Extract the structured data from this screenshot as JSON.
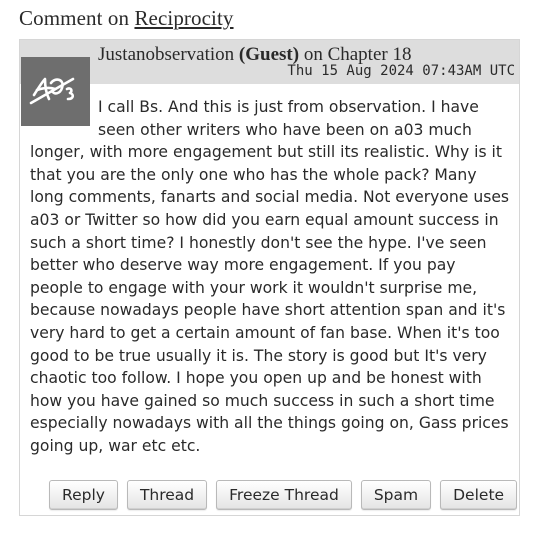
{
  "heading": {
    "prefix": "Comment on",
    "work_title": "Reciprocity"
  },
  "comment": {
    "author": "Justanobservation",
    "guest_tag": "(Guest)",
    "on_text": "on",
    "chapter": "Chapter 18",
    "datetime": "Thu 15 Aug 2024 07:43AM UTC",
    "avatar_icon": "ao3-guest-avatar-icon",
    "body": "I call Bs. And this is just from observation. I have seen other writers who have been on a03 much longer, with more engagement but still its realistic. Why is it that you are the only one who has the whole pack? Many long comments, fanarts and social media. Not everyone uses a03 or Twitter so how did you earn equal amount success in such a short time? I honestly don't see the hype. I've seen better who deserve way more engagement. If you pay people to engage with your work it wouldn't surprise me, because nowadays people have short attention span and it's very hard to get a certain amount of fan base. When it's too good to be true usually it is. The story is good but It's very chaotic too follow. I hope you open up and be honest with how you have gained so much success in such a short time especially nowadays with all the things going on, Gass prices going up, war etc etc."
  },
  "actions": {
    "reply": "Reply",
    "thread": "Thread",
    "freeze_thread": "Freeze Thread",
    "spam": "Spam",
    "delete": "Delete"
  },
  "colors": {
    "header_bg": "#dddddd",
    "avatar_bg": "#6e6e6e",
    "text": "#2a2a2a"
  }
}
